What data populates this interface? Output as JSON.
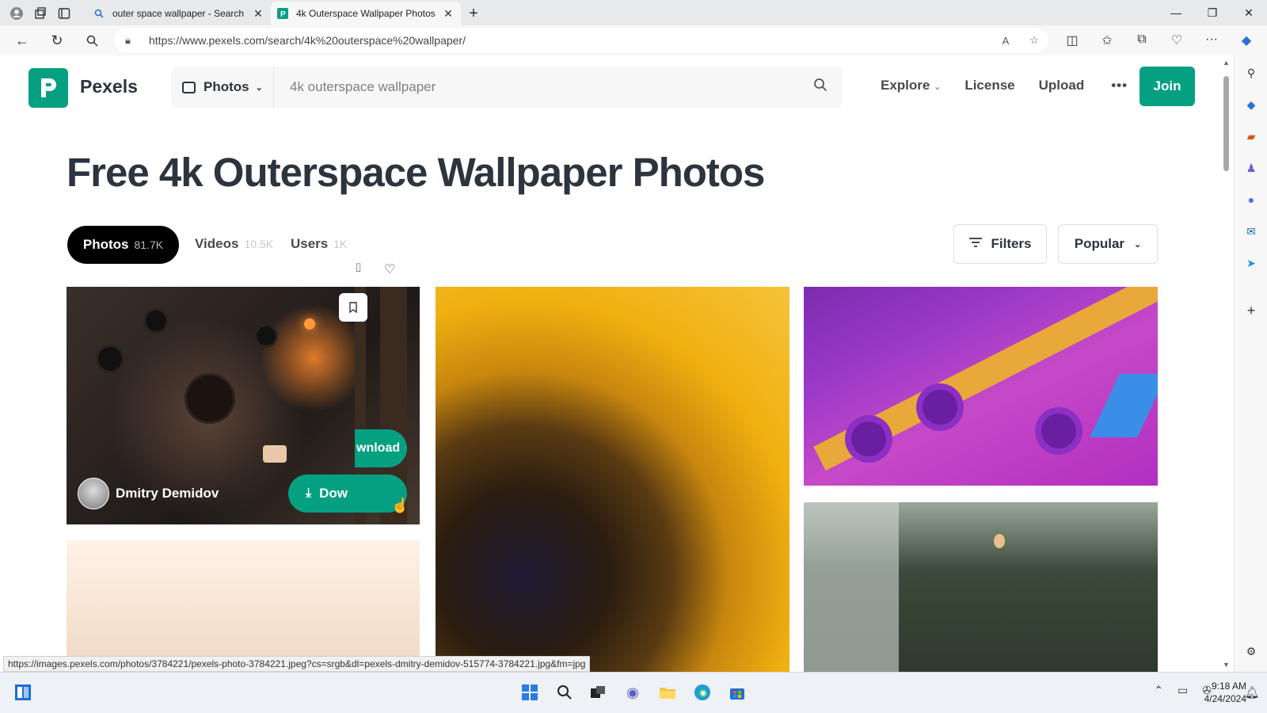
{
  "browser": {
    "tabs": [
      {
        "title": "outer space wallpaper - Search",
        "active": false
      },
      {
        "title": "4k Outerspace Wallpaper Photos",
        "active": true
      }
    ],
    "url": "https://www.pexels.com/search/4k%20outerspace%20wallpaper/",
    "status_url": "https://images.pexels.com/photos/3784221/pexels-photo-3784221.jpeg?cs=srgb&dl=pexels-dmitry-demidov-515774-3784221.jpg&fm=jpg"
  },
  "site": {
    "brand": "Pexels",
    "brand_color": "#05a081",
    "search": {
      "type_label": "Photos",
      "query": "4k outerspace wallpaper"
    },
    "nav": {
      "explore": "Explore",
      "license": "License",
      "upload": "Upload",
      "more": "•••",
      "join": "Join"
    }
  },
  "main": {
    "title": "Free 4k Outerspace Wallpaper Photos",
    "tabs": [
      {
        "label": "Photos",
        "count": "81.7K",
        "active": true
      },
      {
        "label": "Videos",
        "count": "10.5K",
        "active": false
      },
      {
        "label": "Users",
        "count": "1K",
        "active": false
      }
    ],
    "filters_label": "Filters",
    "sort_label": "Popular",
    "photo_overlay": {
      "photographer": "Dmitry Demidov",
      "download_label": "Dow",
      "ghost_download": "wnload"
    }
  },
  "taskbar": {
    "time": "9:18 AM",
    "date": "4/24/2024"
  }
}
